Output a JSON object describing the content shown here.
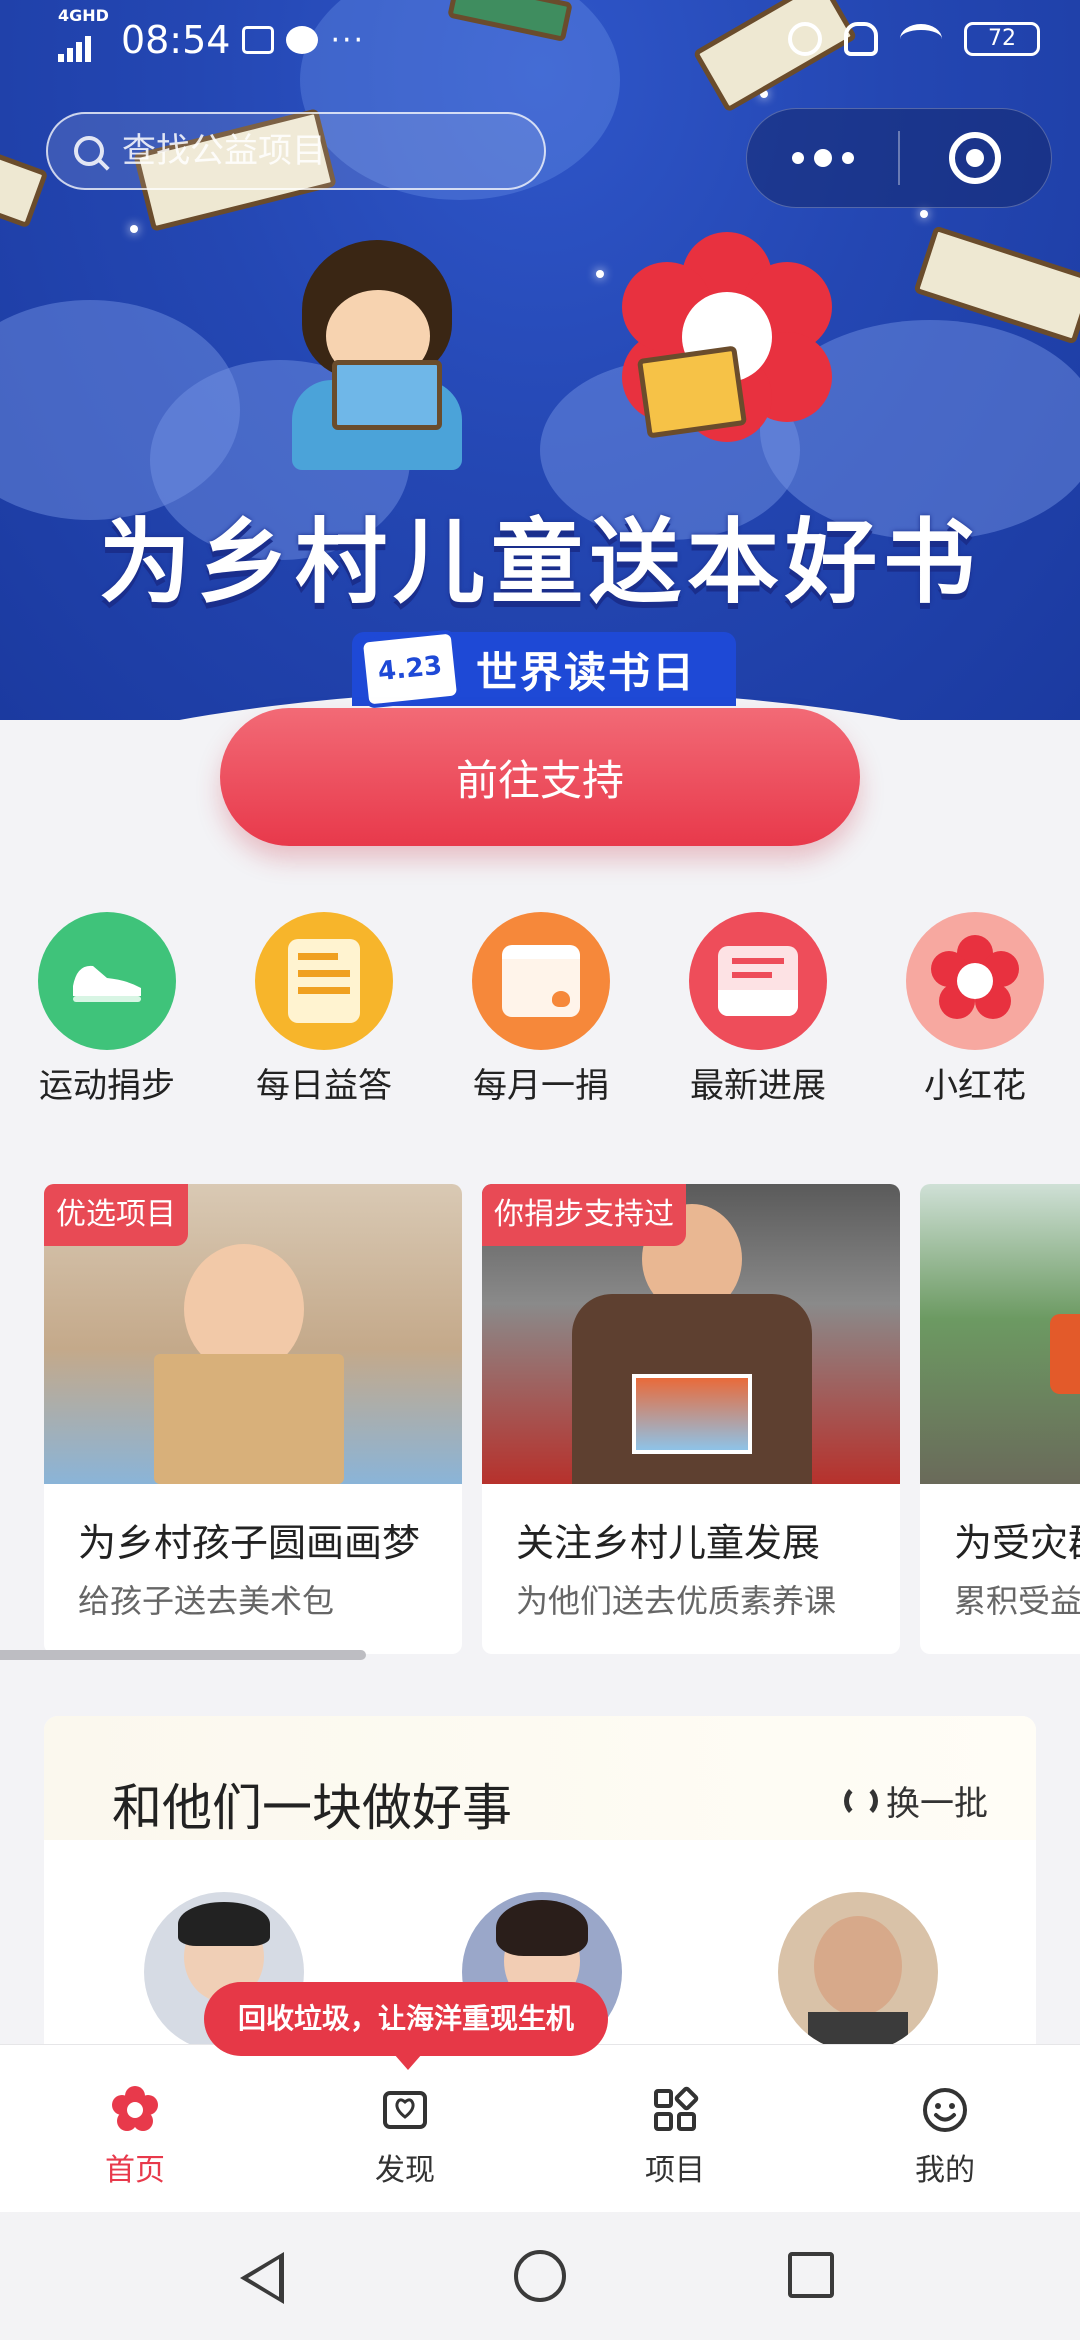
{
  "status_bar": {
    "network": "4GHD",
    "time": "08:54",
    "dots": "···",
    "battery": "72"
  },
  "search": {
    "placeholder": "查找公益项目"
  },
  "hero": {
    "title": "为乡村儿童送本好书",
    "badge_date": "4.23",
    "badge_text": "世界读书日",
    "cta_label": "前往支持"
  },
  "quick_actions": [
    {
      "label": "运动捐步",
      "icon": "sneaker-icon",
      "color": "#3fc37a"
    },
    {
      "label": "每日益答",
      "icon": "quiz-card-icon",
      "color": "#f7b52b"
    },
    {
      "label": "每月一捐",
      "icon": "calendar-heart-icon",
      "color": "#f6883a"
    },
    {
      "label": "最新进展",
      "icon": "inbox-heart-icon",
      "color": "#ee4d5a"
    },
    {
      "label": "小红花",
      "icon": "red-flower-icon",
      "color": "#f7a8a0"
    }
  ],
  "projects": [
    {
      "tag": "优选项目",
      "title": "为乡村孩子圆画画梦",
      "subtitle": "给孩子送去美术包"
    },
    {
      "tag": "你捐步支持过",
      "title": "关注乡村儿童发展",
      "subtitle": "为他们送去优质素养课"
    },
    {
      "tag": "",
      "title": "为受灾群",
      "subtitle": "累积受益"
    }
  ],
  "together": {
    "title": "和他们一块做好事",
    "refresh_label": "换一批"
  },
  "toast": "回收垃圾，让海洋重现生机",
  "tabs": [
    {
      "label": "首页",
      "active": true
    },
    {
      "label": "发现",
      "active": false
    },
    {
      "label": "项目",
      "active": false
    },
    {
      "label": "我的",
      "active": false
    }
  ],
  "colors": {
    "accent": "#e8394b",
    "hero_blue": "#2447b3"
  }
}
